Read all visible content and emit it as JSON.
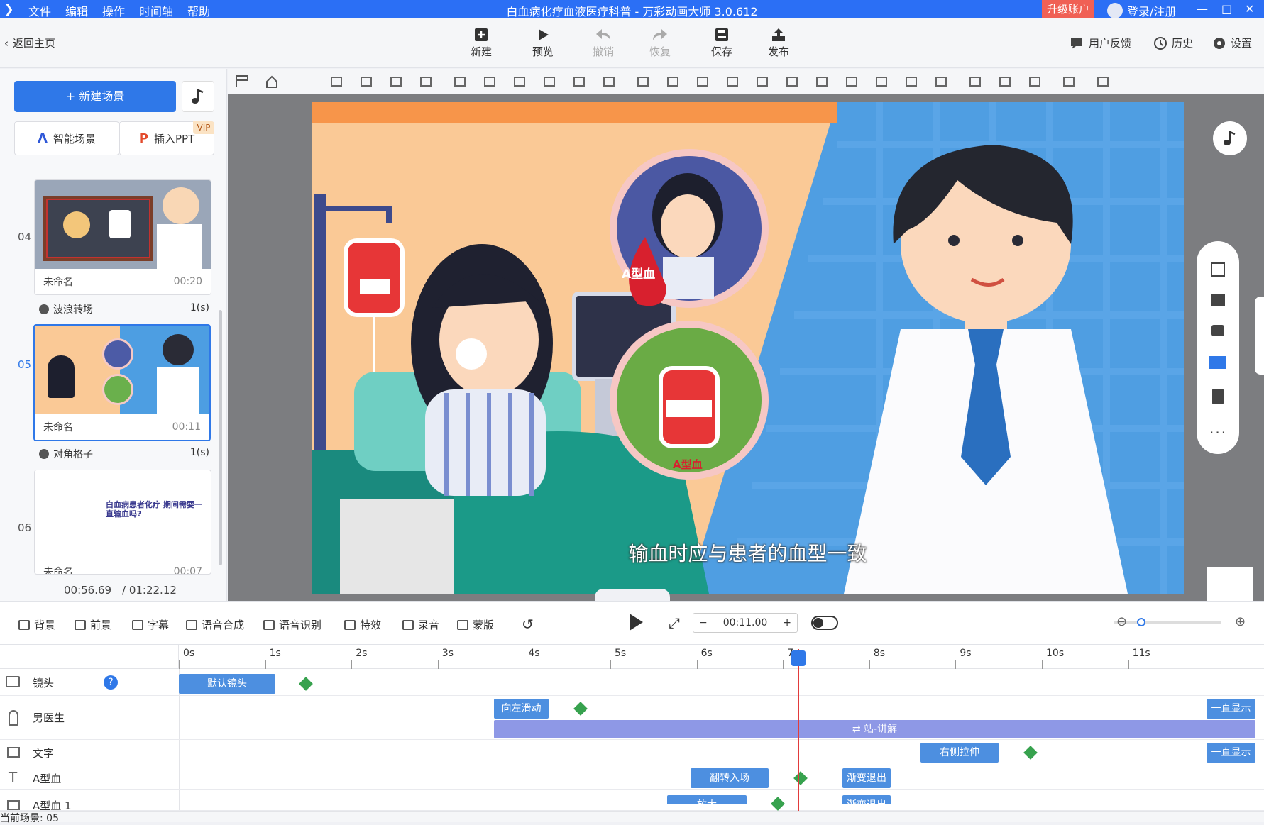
{
  "titlebar": {
    "menu": [
      "文件",
      "编辑",
      "操作",
      "时间轴",
      "帮助"
    ],
    "title": "白血病化疗血液医疗科普 - 万彩动画大师 3.0.612",
    "upgrade": "升级账户",
    "login": "登录/注册",
    "min": "—",
    "max": "□",
    "close": "✕"
  },
  "toolbar": {
    "back": "返回主页",
    "new": "新建",
    "preview": "预览",
    "undo": "撤销",
    "redo": "恢复",
    "save": "保存",
    "publish": "发布",
    "feedback": "用户反馈",
    "history": "历史",
    "settings": "设置"
  },
  "left": {
    "new_scene": "+ 新建场景",
    "ai_scene": "智能场景",
    "insert_ppt": "插入PPT",
    "vip": "VIP",
    "scenes": [
      {
        "num": "04",
        "name": "未命名",
        "dur": "00:20"
      },
      {
        "num": "05",
        "name": "未命名",
        "dur": "00:11"
      },
      {
        "num": "06",
        "name": "未命名",
        "dur": "00:07",
        "thumb_text": "白血病患者化疗 期间需要一直输血吗?"
      }
    ],
    "transitions": [
      {
        "name": "波浪转场",
        "dur": "1(s)"
      },
      {
        "name": "对角格子",
        "dur": "1(s)"
      }
    ],
    "time_current": "00:56.69",
    "time_total": "/ 01:22.12"
  },
  "canvas": {
    "caption": "输血时应与患者的血型一致",
    "blood_label": "A型血",
    "bag_label": "A型血"
  },
  "bottom": {
    "tools": [
      "背景",
      "前景",
      "字幕",
      "语音合成",
      "语音识别",
      "特效",
      "录音",
      "蒙版"
    ],
    "time": "00:11.00",
    "minus": "−",
    "plus": "+"
  },
  "timeline": {
    "ticks": [
      "0s",
      "1s",
      "2s",
      "3s",
      "4s",
      "5s",
      "6s",
      "7s",
      "8s",
      "9s",
      "10s",
      "11s"
    ],
    "tracks": [
      {
        "label": "镜头"
      },
      {
        "label": "男医生"
      },
      {
        "label": "文字"
      },
      {
        "label": "A型血"
      },
      {
        "label": "A型血 1"
      }
    ],
    "clips": {
      "default_cam": "默认镜头",
      "slide_left": "向左滑动",
      "always1": "一直显示",
      "stand": "⇄ 站-讲解",
      "right_stretch": "右侧拉伸",
      "always2": "一直显示",
      "flip_in": "翻转入场",
      "fade_out1": "渐变退出",
      "zoom": "放大",
      "fade_out2": "渐变退出"
    },
    "status": "当前场景: 05"
  },
  "colors": {
    "accent": "#2b6ff5",
    "clip": "#4d8fe0",
    "clip_long": "#8e98e6",
    "keyframe": "#37a24e",
    "playhead": "#e23b3b"
  }
}
